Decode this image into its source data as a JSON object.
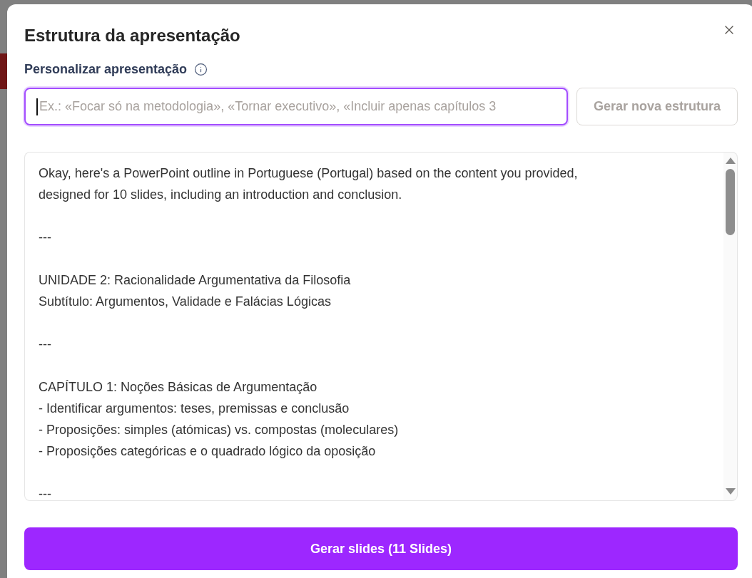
{
  "dialog": {
    "title": "Estrutura da apresentação"
  },
  "customize": {
    "label": "Personalizar apresentação",
    "input": {
      "placeholder": "Ex.: «Focar só na metodologia», «Tornar executivo», «Incluir apenas capítulos 3",
      "focused": true
    },
    "button": {
      "label": "Gerar nova estrutura",
      "disabled": true
    }
  },
  "outline": {
    "value": "Okay, here's a PowerPoint outline in Portuguese (Portugal) based on the content you provided,\ndesigned for 10 slides, including an introduction and conclusion.\n\n---\n\nUNIDADE 2: Racionalidade Argumentativa da Filosofia\nSubtítulo: Argumentos, Validade e Falácias Lógicas\n\n---\n\nCAPÍTULO 1: Noções Básicas de Argumentação\n- Identificar argumentos: teses, premissas e conclusão\n- Proposições: simples (atómicas) vs. compostas (moleculares)\n- Proposições categóricas e o quadrado lógico da oposição\n\n---"
  },
  "generate_button": {
    "label": "Gerar slides (11 Slides)"
  }
}
